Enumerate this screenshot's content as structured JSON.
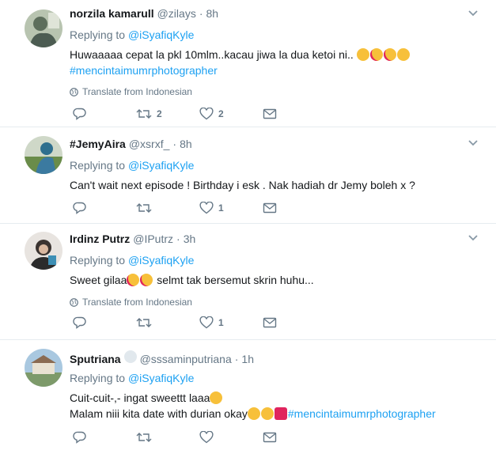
{
  "tweets": [
    {
      "name": "norzila kamarull",
      "handle": "@zilays",
      "dot": "·",
      "time": "8h",
      "replying_label": "Replying to",
      "replying_mention": "@iSyafiqKyle",
      "line1": "Huwaaaaa cepat la pkl 10mlm..kacau jiwa la dua ketoi ni..",
      "line2_link": "#mencintaimumrphotographer",
      "translate": "Translate from Indonesian",
      "retweets": "2",
      "likes": "2"
    },
    {
      "name": "#JemyAira",
      "handle": "@xsrxf_",
      "dot": "·",
      "time": "8h",
      "replying_label": "Replying to",
      "replying_mention": "@iSyafiqKyle",
      "line1": "Can't wait next episode ! Birthday i esk . Nak hadiah dr Jemy boleh x ?",
      "retweets": "",
      "likes": "1"
    },
    {
      "name": "Irdinz Putrz",
      "handle": "@IPutrz",
      "dot": "·",
      "time": "3h",
      "replying_label": "Replying to",
      "replying_mention": "@iSyafiqKyle",
      "line1_a": "Sweet gilaa",
      "line1_b": " selmt tak bersemut skrin huhu...",
      "translate": "Translate from Indonesian",
      "retweets": "",
      "likes": "1"
    },
    {
      "name": "Sputriana",
      "handle": "@sssaminputriana",
      "dot": "·",
      "time": "1h",
      "replying_label": "Replying to",
      "replying_mention": "@iSyafiqKyle",
      "line1": "Cuit-cuit-,- ingat sweettt laaa",
      "line2": "Malam niii kita date with durian okay",
      "line2_link": "#mencintaimumrphotographer",
      "retweets": "",
      "likes": ""
    }
  ],
  "icons": {
    "reply": "reply-icon",
    "retweet": "retweet-icon",
    "like": "heart-icon",
    "dm": "envelope-icon",
    "caret": "chevron-down-icon",
    "globe": "globe-icon"
  },
  "colors": {
    "accent": "#1da1f2",
    "muted": "#657786",
    "divider": "#e6ecf0"
  }
}
